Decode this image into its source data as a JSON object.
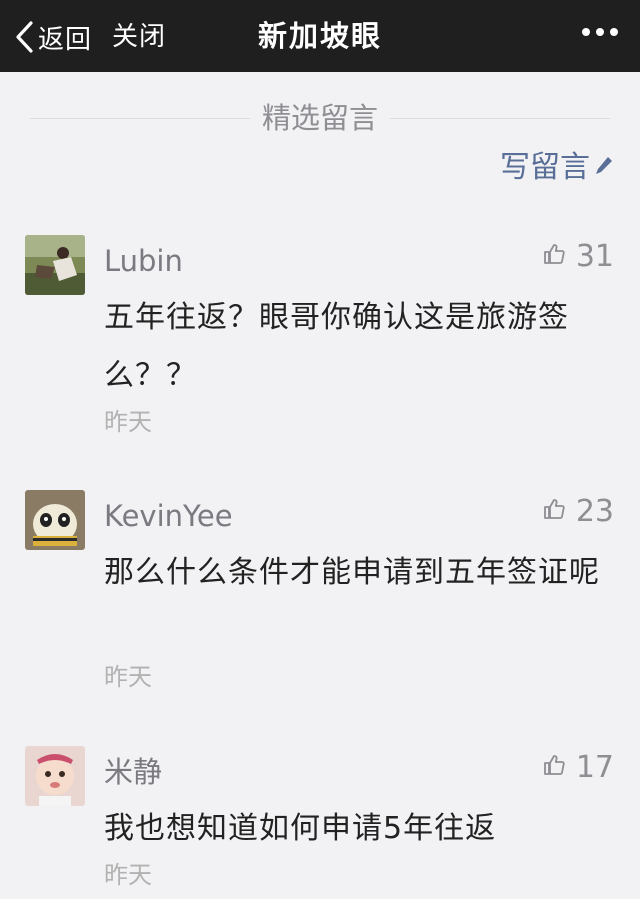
{
  "header": {
    "back_label": "返回",
    "close_label": "关闭",
    "title": "新加坡眼"
  },
  "section": {
    "label": "精选留言",
    "write_label": "写留言"
  },
  "comments": [
    {
      "nickname": "Lubin",
      "likes": "31",
      "content": "五年往返？眼哥你确认这是旅游签么？？",
      "time": "昨天"
    },
    {
      "nickname": "KevinYee",
      "likes": "23",
      "content": "那么什么条件才能申请到五年签证呢",
      "time": "昨天"
    },
    {
      "nickname": "米静",
      "likes": "17",
      "content": "我也想知道如何申请5年往返",
      "time": "昨天"
    }
  ],
  "colors": {
    "topbar": "#1f1f1f",
    "background": "#f2f2f4",
    "link": "#5a6f97",
    "muted": "#8e8e93"
  },
  "icons": [
    "back-chevron-icon",
    "more-dots-icon",
    "pencil-icon",
    "thumbs-up-icon"
  ]
}
